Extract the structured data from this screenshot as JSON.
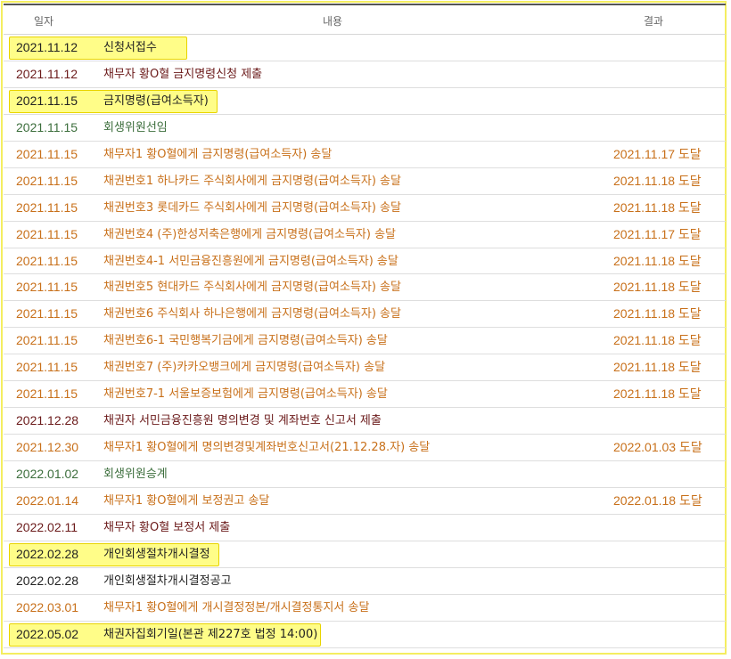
{
  "header": {
    "date": "일자",
    "content": "내용",
    "result": "결과"
  },
  "rows": [
    {
      "date": "2021.11.12",
      "content": "신청서접수",
      "result": "",
      "color": "black",
      "highlight": true
    },
    {
      "date": "2021.11.12",
      "content": "채무자 황O혈 금지명령신청 제출",
      "result": "",
      "color": "maroon",
      "highlight": false
    },
    {
      "date": "2021.11.15",
      "content": "금지명령(급여소득자)",
      "result": "",
      "color": "black",
      "highlight": true
    },
    {
      "date": "2021.11.15",
      "content": "회생위원선임",
      "result": "",
      "color": "green",
      "highlight": false
    },
    {
      "date": "2021.11.15",
      "content": "채무자1 황O혈에게 금지명령(급여소득자) 송달",
      "result": "2021.11.17 도달",
      "color": "orange",
      "highlight": false
    },
    {
      "date": "2021.11.15",
      "content": "채권번호1 하나카드 주식회사에게 금지명령(급여소득자) 송달",
      "result": "2021.11.18 도달",
      "color": "orange",
      "highlight": false
    },
    {
      "date": "2021.11.15",
      "content": "채권번호3 롯데카드 주식회사에게 금지명령(급여소득자) 송달",
      "result": "2021.11.18 도달",
      "color": "orange",
      "highlight": false
    },
    {
      "date": "2021.11.15",
      "content": "채권번호4 (주)한성저축은행에게 금지명령(급여소득자) 송달",
      "result": "2021.11.17 도달",
      "color": "orange",
      "highlight": false
    },
    {
      "date": "2021.11.15",
      "content": "채권번호4-1 서민금융진흥원에게 금지명령(급여소득자) 송달",
      "result": "2021.11.18 도달",
      "color": "orange",
      "highlight": false
    },
    {
      "date": "2021.11.15",
      "content": "채권번호5 현대카드 주식회사에게 금지명령(급여소득자) 송달",
      "result": "2021.11.18 도달",
      "color": "orange",
      "highlight": false
    },
    {
      "date": "2021.11.15",
      "content": "채권번호6 주식회사 하나은행에게 금지명령(급여소득자) 송달",
      "result": "2021.11.18 도달",
      "color": "orange",
      "highlight": false
    },
    {
      "date": "2021.11.15",
      "content": "채권번호6-1 국민행복기금에게 금지명령(급여소득자) 송달",
      "result": "2021.11.18 도달",
      "color": "orange",
      "highlight": false
    },
    {
      "date": "2021.11.15",
      "content": "채권번호7 (주)카카오뱅크에게 금지명령(급여소득자) 송달",
      "result": "2021.11.18 도달",
      "color": "orange",
      "highlight": false
    },
    {
      "date": "2021.11.15",
      "content": "채권번호7-1 서울보증보험에게 금지명령(급여소득자) 송달",
      "result": "2021.11.18 도달",
      "color": "orange",
      "highlight": false
    },
    {
      "date": "2021.12.28",
      "content": "채권자 서민금융진흥원 명의변경 및 계좌번호 신고서 제출",
      "result": "",
      "color": "maroon",
      "highlight": false
    },
    {
      "date": "2021.12.30",
      "content": "채무자1 황O혈에게 명의변경및계좌번호신고서(21.12.28.자) 송달",
      "result": "2022.01.03 도달",
      "color": "orange",
      "highlight": false
    },
    {
      "date": "2022.01.02",
      "content": "회생위원승계",
      "result": "",
      "color": "green",
      "highlight": false
    },
    {
      "date": "2022.01.14",
      "content": "채무자1 황O혈에게 보정권고 송달",
      "result": "2022.01.18 도달",
      "color": "orange",
      "highlight": false
    },
    {
      "date": "2022.02.11",
      "content": "채무자 황O혈 보정서 제출",
      "result": "",
      "color": "maroon",
      "highlight": false
    },
    {
      "date": "2022.02.28",
      "content": "개인회생절차개시결정",
      "result": "",
      "color": "black",
      "highlight": true
    },
    {
      "date": "2022.02.28",
      "content": "개인회생절차개시결정공고",
      "result": "",
      "color": "black",
      "highlight": false
    },
    {
      "date": "2022.03.01",
      "content": "채무자1 황O혈에게 개시결정정본/개시결정통지서 송달",
      "result": "",
      "color": "orange",
      "highlight": false
    },
    {
      "date": "2022.05.02",
      "content": "채권자집회기일(본관 제227호 법정 14:00)",
      "result": "",
      "color": "black",
      "highlight": true
    }
  ]
}
